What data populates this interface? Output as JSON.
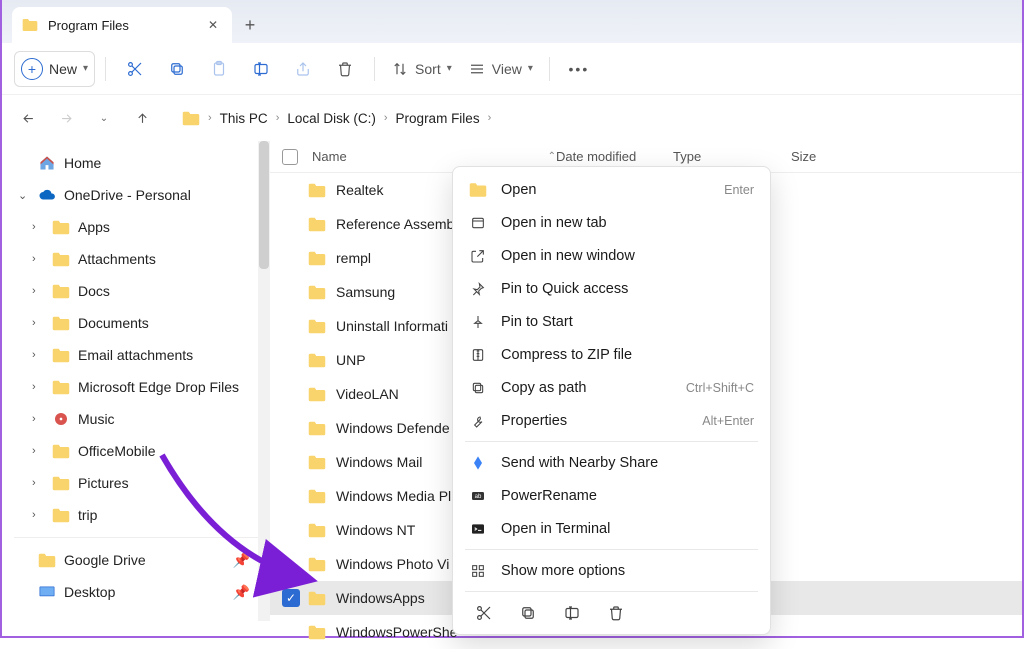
{
  "tab": {
    "title": "Program Files"
  },
  "toolbar": {
    "new_label": "New",
    "sort_label": "Sort",
    "view_label": "View"
  },
  "breadcrumbs": [
    "This PC",
    "Local Disk (C:)",
    "Program Files"
  ],
  "sidebar": {
    "home": "Home",
    "onedrive": "OneDrive - Personal",
    "items": [
      "Apps",
      "Attachments",
      "Docs",
      "Documents",
      "Email attachments",
      "Microsoft Edge Drop Files",
      "Music",
      "OfficeMobile",
      "Pictures",
      "trip"
    ],
    "quick": [
      "Google Drive",
      "Desktop"
    ]
  },
  "columns": {
    "name": "Name",
    "date": "Date modified",
    "type": "Type",
    "size": "Size"
  },
  "files": [
    {
      "name": "Realtek"
    },
    {
      "name": "Reference Assemb"
    },
    {
      "name": "rempl"
    },
    {
      "name": "Samsung"
    },
    {
      "name": "Uninstall Informati"
    },
    {
      "name": "UNP"
    },
    {
      "name": "VideoLAN"
    },
    {
      "name": "Windows Defende"
    },
    {
      "name": "Windows Mail"
    },
    {
      "name": "Windows Media Pl"
    },
    {
      "name": "Windows NT"
    },
    {
      "name": "Windows Photo Vi"
    },
    {
      "name": "WindowsApps",
      "selected": true
    },
    {
      "name": "WindowsPowerShe"
    }
  ],
  "context_menu": {
    "open": "Open",
    "open_hint": "Enter",
    "open_tab": "Open in new tab",
    "open_window": "Open in new window",
    "pin_quick": "Pin to Quick access",
    "pin_start": "Pin to Start",
    "compress": "Compress to ZIP file",
    "copy_path": "Copy as path",
    "copy_path_hint": "Ctrl+Shift+C",
    "properties": "Properties",
    "properties_hint": "Alt+Enter",
    "nearby": "Send with Nearby Share",
    "powerrename": "PowerRename",
    "terminal": "Open in Terminal",
    "more": "Show more options"
  }
}
